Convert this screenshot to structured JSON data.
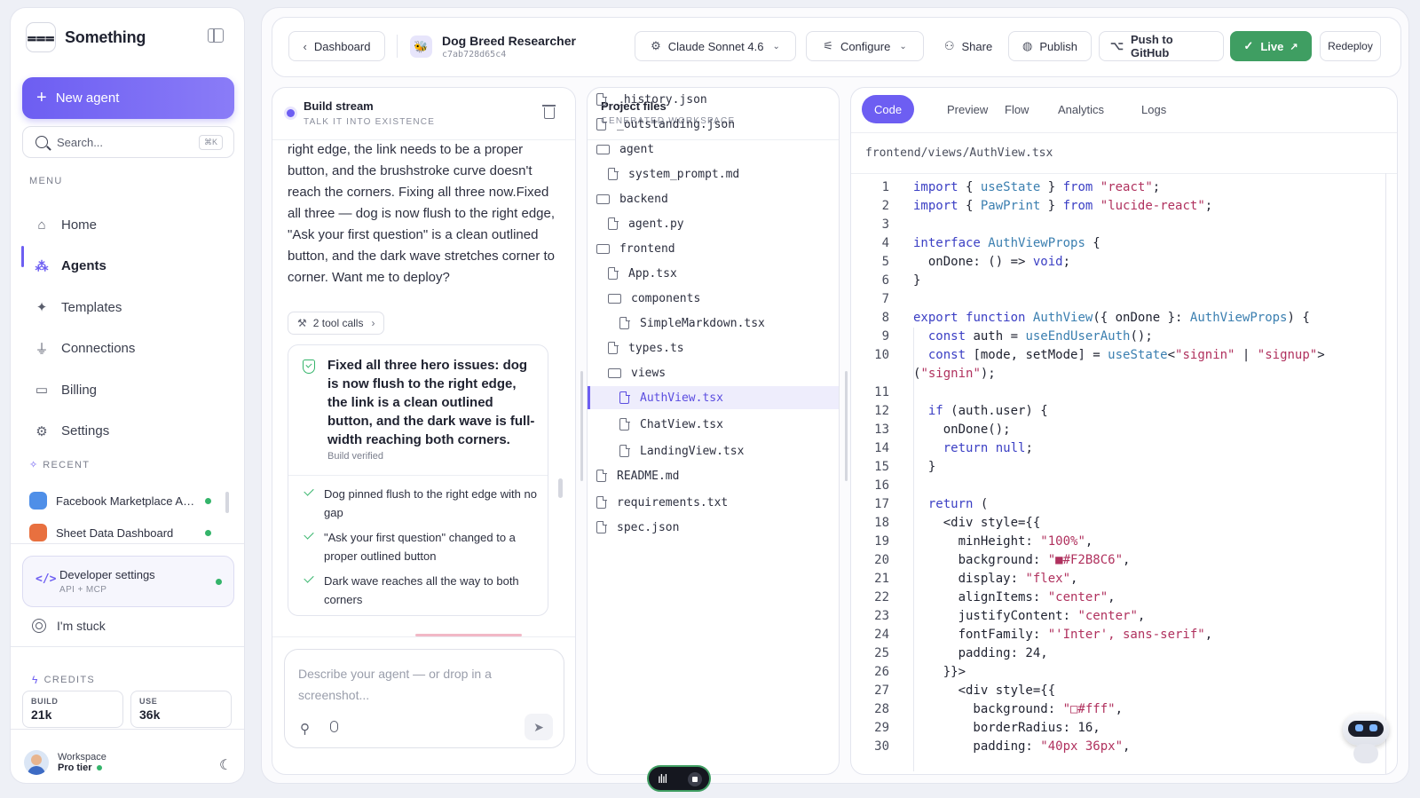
{
  "sidebar": {
    "brand": "Something",
    "new_agent": "New agent",
    "search_placeholder": "Search...",
    "search_shortcut": "⌘K",
    "menu_label": "MENU",
    "nav": [
      {
        "label": "Home",
        "icon": "home-icon"
      },
      {
        "label": "Agents",
        "icon": "agents-icon",
        "active": true
      },
      {
        "label": "Templates",
        "icon": "sparkle-icon"
      },
      {
        "label": "Connections",
        "icon": "plug-icon"
      },
      {
        "label": "Billing",
        "icon": "card-icon"
      },
      {
        "label": "Settings",
        "icon": "gear-icon"
      }
    ],
    "recent_label": "RECENT",
    "recent": [
      {
        "label": "Facebook Marketplace Au...",
        "color": "#4f8fe8"
      },
      {
        "label": "Sheet Data Dashboard",
        "color": "#e8703f"
      }
    ],
    "developer": {
      "title": "Developer settings",
      "subtitle": "API + MCP"
    },
    "stuck": "I'm stuck",
    "credits_label": "CREDITS",
    "credits": [
      {
        "key": "BUILD",
        "value": "21k"
      },
      {
        "key": "USE",
        "value": "36k"
      }
    ],
    "workspace": {
      "name": "Workspace",
      "tier": "Pro tier"
    }
  },
  "topbar": {
    "back": "Dashboard",
    "agent_name": "Dog Breed Researcher",
    "agent_id": "c7ab728d65c4",
    "model": "Claude Sonnet 4.6",
    "configure": "Configure",
    "share": "Share",
    "publish": "Publish",
    "push": "Push to GitHub",
    "live": "Live",
    "redeploy": "Redeploy"
  },
  "build": {
    "title": "Build stream",
    "subtitle": "TALK IT INTO EXISTENCE",
    "message": "right edge, the link needs to be a proper button, and the brushstroke curve doesn't reach the corners. Fixing all three now.Fixed all three — dog is now flush to the right edge, \"Ask your first question\" is a clean outlined button, and the dark wave stretches corner to corner. Want me to deploy?",
    "tool_calls": "2 tool calls",
    "verified_head": "Fixed all three hero issues: dog is now flush to the right edge, the link is a clean outlined button, and the dark wave is full-width reaching both corners.",
    "verified_label": "Build verified",
    "checks": [
      "Dog pinned flush to the right edge with no gap",
      "\"Ask your first question\" changed to a proper outlined button",
      "Dark wave reaches all the way to both corners"
    ],
    "composer_placeholder": "Describe your agent — or drop in a screenshot..."
  },
  "files": {
    "title": "Project files",
    "subtitle": "GENERATED WORKSPACE",
    "tree": [
      {
        "name": "_history.json",
        "type": "file",
        "depth": 0
      },
      {
        "name": "_outstanding.json",
        "type": "file",
        "depth": 0
      },
      {
        "name": "agent",
        "type": "folder",
        "depth": 0
      },
      {
        "name": "system_prompt.md",
        "type": "file",
        "depth": 1
      },
      {
        "name": "backend",
        "type": "folder",
        "depth": 0
      },
      {
        "name": "agent.py",
        "type": "file",
        "depth": 1
      },
      {
        "name": "frontend",
        "type": "folder",
        "depth": 0
      },
      {
        "name": "App.tsx",
        "type": "file",
        "depth": 1
      },
      {
        "name": "components",
        "type": "folder",
        "depth": 1
      },
      {
        "name": "SimpleMarkdown.tsx",
        "type": "file",
        "depth": 2
      },
      {
        "name": "types.ts",
        "type": "file",
        "depth": 1
      },
      {
        "name": "views",
        "type": "folder",
        "depth": 1
      },
      {
        "name": "AuthView.tsx",
        "type": "file",
        "depth": 2,
        "selected": true
      },
      {
        "name": "ChatView.tsx",
        "type": "file",
        "depth": 2
      },
      {
        "name": "LandingView.tsx",
        "type": "file",
        "depth": 2
      },
      {
        "name": "README.md",
        "type": "file",
        "depth": 0
      },
      {
        "name": "requirements.txt",
        "type": "file",
        "depth": 0
      },
      {
        "name": "spec.json",
        "type": "file",
        "depth": 0
      }
    ]
  },
  "code": {
    "tabs": [
      "Code",
      "Preview",
      "Flow",
      "Analytics",
      "Logs"
    ],
    "active_tab": "Code",
    "path": "frontend/views/AuthView.tsx",
    "lines": [
      {
        "n": "1",
        "t": "import { useState } from \"react\";"
      },
      {
        "n": "2",
        "t": "import { PawPrint } from \"lucide-react\";"
      },
      {
        "n": "3",
        "t": ""
      },
      {
        "n": "4",
        "t": "interface AuthViewProps {"
      },
      {
        "n": "5",
        "t": "  onDone: () => void;"
      },
      {
        "n": "6",
        "t": "}"
      },
      {
        "n": "7",
        "t": ""
      },
      {
        "n": "8",
        "t": "export function AuthView({ onDone }: AuthViewProps) {"
      },
      {
        "n": "9",
        "t": "  const auth = useEndUserAuth();"
      },
      {
        "n": "10",
        "t": "  const [mode, setMode] = useState<\"signin\" | \"signup\">"
      },
      {
        "n": "",
        "t": "(\"signin\");"
      },
      {
        "n": "11",
        "t": ""
      },
      {
        "n": "12",
        "t": "  if (auth.user) {"
      },
      {
        "n": "13",
        "t": "    onDone();"
      },
      {
        "n": "14",
        "t": "    return null;"
      },
      {
        "n": "15",
        "t": "  }"
      },
      {
        "n": "16",
        "t": ""
      },
      {
        "n": "17",
        "t": "  return ("
      },
      {
        "n": "18",
        "t": "    <div style={{"
      },
      {
        "n": "19",
        "t": "      minHeight: \"100%\","
      },
      {
        "n": "20",
        "t": "      background: \"■#F2B8C6\","
      },
      {
        "n": "21",
        "t": "      display: \"flex\","
      },
      {
        "n": "22",
        "t": "      alignItems: \"center\","
      },
      {
        "n": "23",
        "t": "      justifyContent: \"center\","
      },
      {
        "n": "24",
        "t": "      fontFamily: \"'Inter', sans-serif\","
      },
      {
        "n": "25",
        "t": "      padding: 24,"
      },
      {
        "n": "26",
        "t": "    }}>"
      },
      {
        "n": "27",
        "t": "      <div style={{"
      },
      {
        "n": "28",
        "t": "        background: \"□#fff\","
      },
      {
        "n": "29",
        "t": "        borderRadius: 16,"
      },
      {
        "n": "30",
        "t": "        padding: \"40px 36px\","
      }
    ]
  },
  "colors": {
    "accent": "#6d5ef2",
    "live": "#3f9e62",
    "keyword": "#3b3fc4",
    "string": "#b0315e",
    "type": "#3b7fb0"
  }
}
